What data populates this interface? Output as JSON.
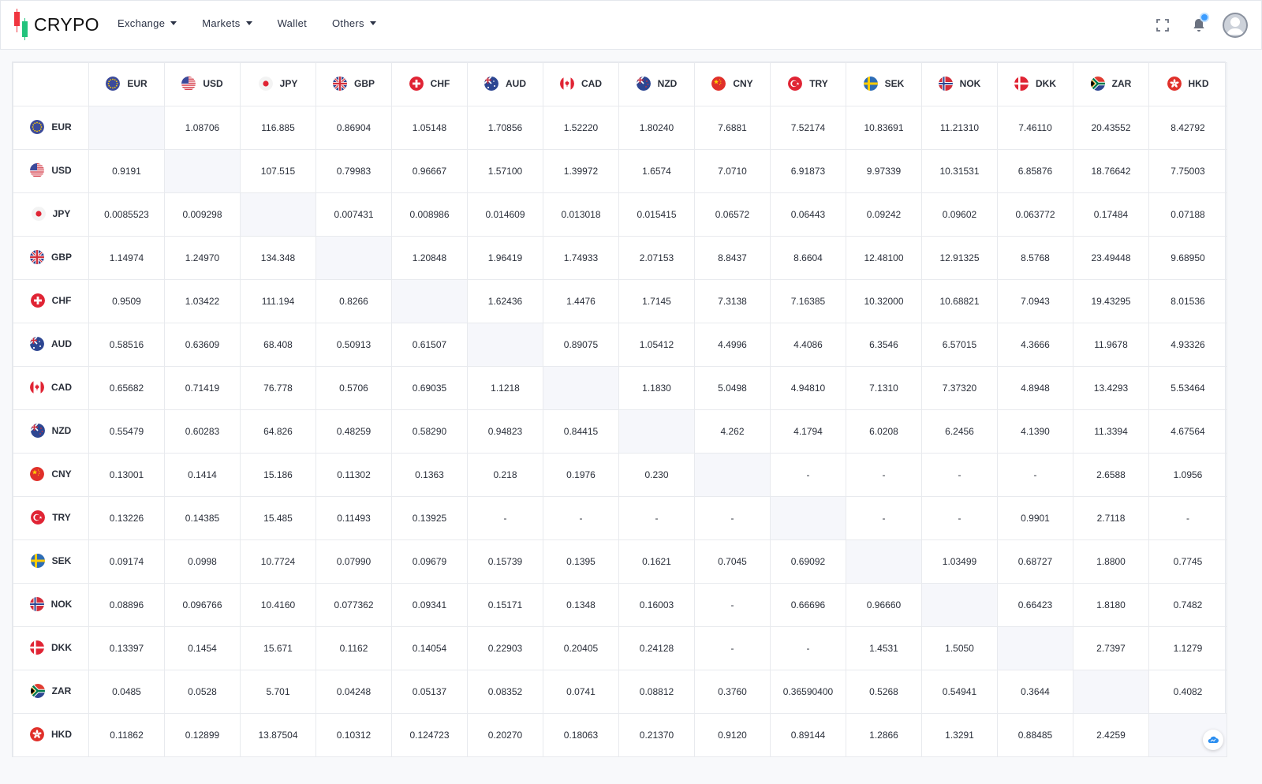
{
  "app": {
    "logo_text": "CRYPO"
  },
  "nav": [
    {
      "label": "Exchange",
      "dropdown": true
    },
    {
      "label": "Markets",
      "dropdown": true
    },
    {
      "label": "Wallet",
      "dropdown": false
    },
    {
      "label": "Others",
      "dropdown": true
    }
  ],
  "header_tools": {
    "fullscreen_icon": "fullscreen-icon",
    "notification_icon": "bell-icon",
    "avatar_icon": "user-avatar"
  },
  "currencies": [
    "EUR",
    "USD",
    "JPY",
    "GBP",
    "CHF",
    "AUD",
    "CAD",
    "NZD",
    "CNY",
    "TRY",
    "SEK",
    "NOK",
    "DKK",
    "ZAR",
    "HKD"
  ],
  "flag_icons": {
    "EUR": "eu-flag-icon",
    "USD": "us-flag-icon",
    "JPY": "jp-flag-icon",
    "GBP": "gb-flag-icon",
    "CHF": "ch-flag-icon",
    "AUD": "au-flag-icon",
    "CAD": "ca-flag-icon",
    "NZD": "nz-flag-icon",
    "CNY": "cn-flag-icon",
    "TRY": "tr-flag-icon",
    "SEK": "se-flag-icon",
    "NOK": "no-flag-icon",
    "DKK": "dk-flag-icon",
    "ZAR": "za-flag-icon",
    "HKD": "hk-flag-icon"
  },
  "rates": [
    [
      "",
      "1.08706",
      "116.885",
      "0.86904",
      "1.05148",
      "1.70856",
      "1.52220",
      "1.80240",
      "7.6881",
      "7.52174",
      "10.83691",
      "11.21310",
      "7.46110",
      "20.43552",
      "8.42792"
    ],
    [
      "0.9191",
      "",
      "107.515",
      "0.79983",
      "0.96667",
      "1.57100",
      "1.39972",
      "1.6574",
      "7.0710",
      "6.91873",
      "9.97339",
      "10.31531",
      "6.85876",
      "18.76642",
      "7.75003"
    ],
    [
      "0.0085523",
      "0.009298",
      "",
      "0.007431",
      "0.008986",
      "0.014609",
      "0.013018",
      "0.015415",
      "0.06572",
      "0.06443",
      "0.09242",
      "0.09602",
      "0.063772",
      "0.17484",
      "0.07188"
    ],
    [
      "1.14974",
      "1.24970",
      "134.348",
      "",
      "1.20848",
      "1.96419",
      "1.74933",
      "2.07153",
      "8.8437",
      "8.6604",
      "12.48100",
      "12.91325",
      "8.5768",
      "23.49448",
      "9.68950"
    ],
    [
      "0.9509",
      "1.03422",
      "111.194",
      "0.8266",
      "",
      "1.62436",
      "1.4476",
      "1.7145",
      "7.3138",
      "7.16385",
      "10.32000",
      "10.68821",
      "7.0943",
      "19.43295",
      "8.01536"
    ],
    [
      "0.58516",
      "0.63609",
      "68.408",
      "0.50913",
      "0.61507",
      "",
      "0.89075",
      "1.05412",
      "4.4996",
      "4.4086",
      "6.3546",
      "6.57015",
      "4.3666",
      "11.9678",
      "4.93326"
    ],
    [
      "0.65682",
      "0.71419",
      "76.778",
      "0.5706",
      "0.69035",
      "1.1218",
      "",
      "1.1830",
      "5.0498",
      "4.94810",
      "7.1310",
      "7.37320",
      "4.8948",
      "13.4293",
      "5.53464"
    ],
    [
      "0.55479",
      "0.60283",
      "64.826",
      "0.48259",
      "0.58290",
      "0.94823",
      "0.84415",
      "",
      "4.262",
      "4.1794",
      "6.0208",
      "6.2456",
      "4.1390",
      "11.3394",
      "4.67564"
    ],
    [
      "0.13001",
      "0.1414",
      "15.186",
      "0.11302",
      "0.1363",
      "0.218",
      "0.1976",
      "0.230",
      "",
      "-",
      "-",
      "-",
      "-",
      "2.6588",
      "1.0956"
    ],
    [
      "0.13226",
      "0.14385",
      "15.485",
      "0.11493",
      "0.13925",
      "-",
      "-",
      "-",
      "-",
      "",
      "-",
      "-",
      "0.9901",
      "2.7118",
      "-"
    ],
    [
      "0.09174",
      "0.0998",
      "10.7724",
      "0.07990",
      "0.09679",
      "0.15739",
      "0.1395",
      "0.1621",
      "0.7045",
      "0.69092",
      "",
      "1.03499",
      "0.68727",
      "1.8800",
      "0.7745"
    ],
    [
      "0.08896",
      "0.096766",
      "10.4160",
      "0.077362",
      "0.09341",
      "0.15171",
      "0.1348",
      "0.16003",
      "-",
      "0.66696",
      "0.96660",
      "",
      "0.66423",
      "1.8180",
      "0.7482"
    ],
    [
      "0.13397",
      "0.1454",
      "15.671",
      "0.1162",
      "0.14054",
      "0.22903",
      "0.20405",
      "0.24128",
      "-",
      "-",
      "1.4531",
      "1.5050",
      "",
      "2.7397",
      "1.1279"
    ],
    [
      "0.0485",
      "0.0528",
      "5.701",
      "0.04248",
      "0.05137",
      "0.08352",
      "0.0741",
      "0.08812",
      "0.3760",
      "0.36590400",
      "0.5268",
      "0.54941",
      "0.3644",
      "",
      "0.4082"
    ],
    [
      "0.11862",
      "0.12899",
      "13.87504",
      "0.10312",
      "0.124723",
      "0.20270",
      "0.18063",
      "0.21370",
      "0.9120",
      "0.89144",
      "1.2866",
      "1.3291",
      "0.88485",
      "2.4259",
      ""
    ]
  ],
  "chat_icon": "chat-cloud-icon"
}
